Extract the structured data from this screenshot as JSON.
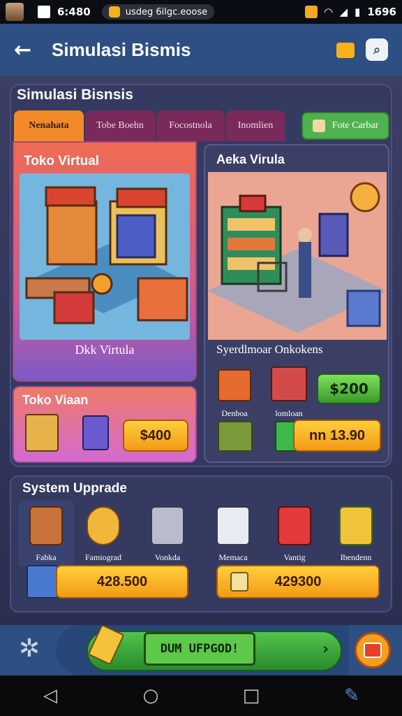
{
  "status_bar": {
    "time": "6:480",
    "notification": "usdeg 6ilgc.eoose",
    "battery": "1696"
  },
  "app_bar": {
    "back_label": "←",
    "title": "Simulasi Bismis"
  },
  "main_panel": {
    "title": "Simulasi Bisnsis",
    "tabs": [
      {
        "label": "Nenahata",
        "active": true
      },
      {
        "label": "Tobe Boehn",
        "active": false
      },
      {
        "label": "Focostnola",
        "active": false
      },
      {
        "label": "Inomlien",
        "active": false
      }
    ],
    "foto_button": "Fote Carbar"
  },
  "store_left": {
    "title": "Toko Virtual",
    "caption": "Dkk Virtula"
  },
  "store_right": {
    "title": "Aeka Virula",
    "subtitle": "Syerdlmoar Onkokens",
    "buy_button": "$200",
    "items": [
      "Denboa",
      "lomloan"
    ],
    "price_button": "nn 13.90"
  },
  "small_card": {
    "title": "Toko Viaan",
    "price_button": "$400"
  },
  "system_upgrade": {
    "title": "System Upprade",
    "items": [
      {
        "label": "Fabka",
        "icon": "crate-icon"
      },
      {
        "label": "Famiograd",
        "icon": "gold-coin-icon"
      },
      {
        "label": "Vonkda",
        "icon": "machine-icon"
      },
      {
        "label": "Memaca",
        "icon": "server-icon"
      },
      {
        "label": "Vantig",
        "icon": "cup-icon"
      },
      {
        "label": "Ibendenn",
        "icon": "cube-stack-icon"
      }
    ],
    "price_left": "428.500",
    "price_right": "429300"
  },
  "bottom_bar": {
    "upgrade_label": "DUM UFPGOD!"
  },
  "colors": {
    "appbar": "#2d4f82",
    "panel": "#353a60",
    "gold": "#f6b21d",
    "green": "#4fb24f",
    "tab_active": "#f38a2a",
    "tab_inactive": "#7a2a5a"
  }
}
